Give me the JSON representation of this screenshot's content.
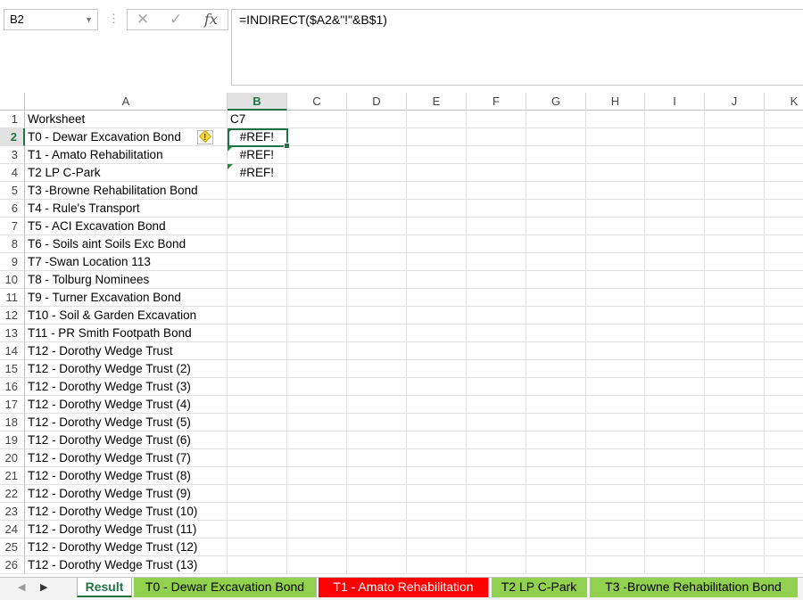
{
  "name_box": {
    "value": "B2"
  },
  "formula_bar": {
    "cancel_glyph": "✕",
    "enter_glyph": "✓",
    "fx_label": "fx",
    "formula": "=INDIRECT($A2&\"!\"&B$1)"
  },
  "columns": [
    "A",
    "B",
    "C",
    "D",
    "E",
    "F",
    "G",
    "H",
    "I",
    "J",
    "K"
  ],
  "rows": [
    {
      "n": "1",
      "a": "Worksheet",
      "b": "C7"
    },
    {
      "n": "2",
      "a": "T0 - Dewar Excavation Bond",
      "b": "#REF!"
    },
    {
      "n": "3",
      "a": "T1 - Amato Rehabilitation",
      "b": "#REF!"
    },
    {
      "n": "4",
      "a": "T2 LP C-Park",
      "b": "#REF!"
    },
    {
      "n": "5",
      "a": "T3 -Browne Rehabilitation Bond",
      "b": ""
    },
    {
      "n": "6",
      "a": "T4 - Rule's Transport",
      "b": ""
    },
    {
      "n": "7",
      "a": "T5 - ACI Excavation Bond",
      "b": ""
    },
    {
      "n": "8",
      "a": "T6 - Soils aint Soils Exc Bond",
      "b": ""
    },
    {
      "n": "9",
      "a": "T7 -Swan Location 113",
      "b": ""
    },
    {
      "n": "10",
      "a": "T8 - Tolburg Nominees",
      "b": ""
    },
    {
      "n": "11",
      "a": "T9 - Turner Excavation Bond",
      "b": ""
    },
    {
      "n": "12",
      "a": "T10 - Soil & Garden Excavation",
      "b": ""
    },
    {
      "n": "13",
      "a": "T11 - PR Smith Footpath Bond",
      "b": ""
    },
    {
      "n": "14",
      "a": "T12 - Dorothy Wedge Trust",
      "b": ""
    },
    {
      "n": "15",
      "a": "T12 - Dorothy Wedge Trust (2)",
      "b": ""
    },
    {
      "n": "16",
      "a": "T12 - Dorothy Wedge Trust (3)",
      "b": ""
    },
    {
      "n": "17",
      "a": "T12 - Dorothy Wedge Trust (4)",
      "b": ""
    },
    {
      "n": "18",
      "a": "T12 - Dorothy Wedge Trust (5)",
      "b": ""
    },
    {
      "n": "19",
      "a": "T12 - Dorothy Wedge Trust (6)",
      "b": ""
    },
    {
      "n": "20",
      "a": "T12 - Dorothy Wedge Trust (7)",
      "b": ""
    },
    {
      "n": "21",
      "a": "T12 - Dorothy Wedge Trust (8)",
      "b": ""
    },
    {
      "n": "22",
      "a": "T12 - Dorothy Wedge Trust (9)",
      "b": ""
    },
    {
      "n": "23",
      "a": "T12 - Dorothy Wedge Trust (10)",
      "b": ""
    },
    {
      "n": "24",
      "a": "T12 - Dorothy Wedge Trust (11)",
      "b": ""
    },
    {
      "n": "25",
      "a": "T12 - Dorothy Wedge Trust (12)",
      "b": ""
    },
    {
      "n": "26",
      "a": "T12 - Dorothy Wedge Trust (13)",
      "b": ""
    }
  ],
  "sheet_tabs": [
    {
      "label": "Result",
      "state": "active"
    },
    {
      "label": "T0 - Dewar Excavation Bond",
      "color": "#92d050"
    },
    {
      "label": "T1 - Amato Rehabilitation",
      "color": "#ff0000"
    },
    {
      "label": "T2 LP C-Park",
      "color": "#92d050"
    },
    {
      "label": "T3 -Browne Rehabilitation Bond",
      "color": "#92d050"
    }
  ],
  "tab_nav": {
    "prev_glyph": "◀",
    "next_glyph": "▶"
  },
  "colors": {
    "accent": "#217346",
    "tab_green": "#92d050",
    "tab_red": "#ff0000"
  }
}
